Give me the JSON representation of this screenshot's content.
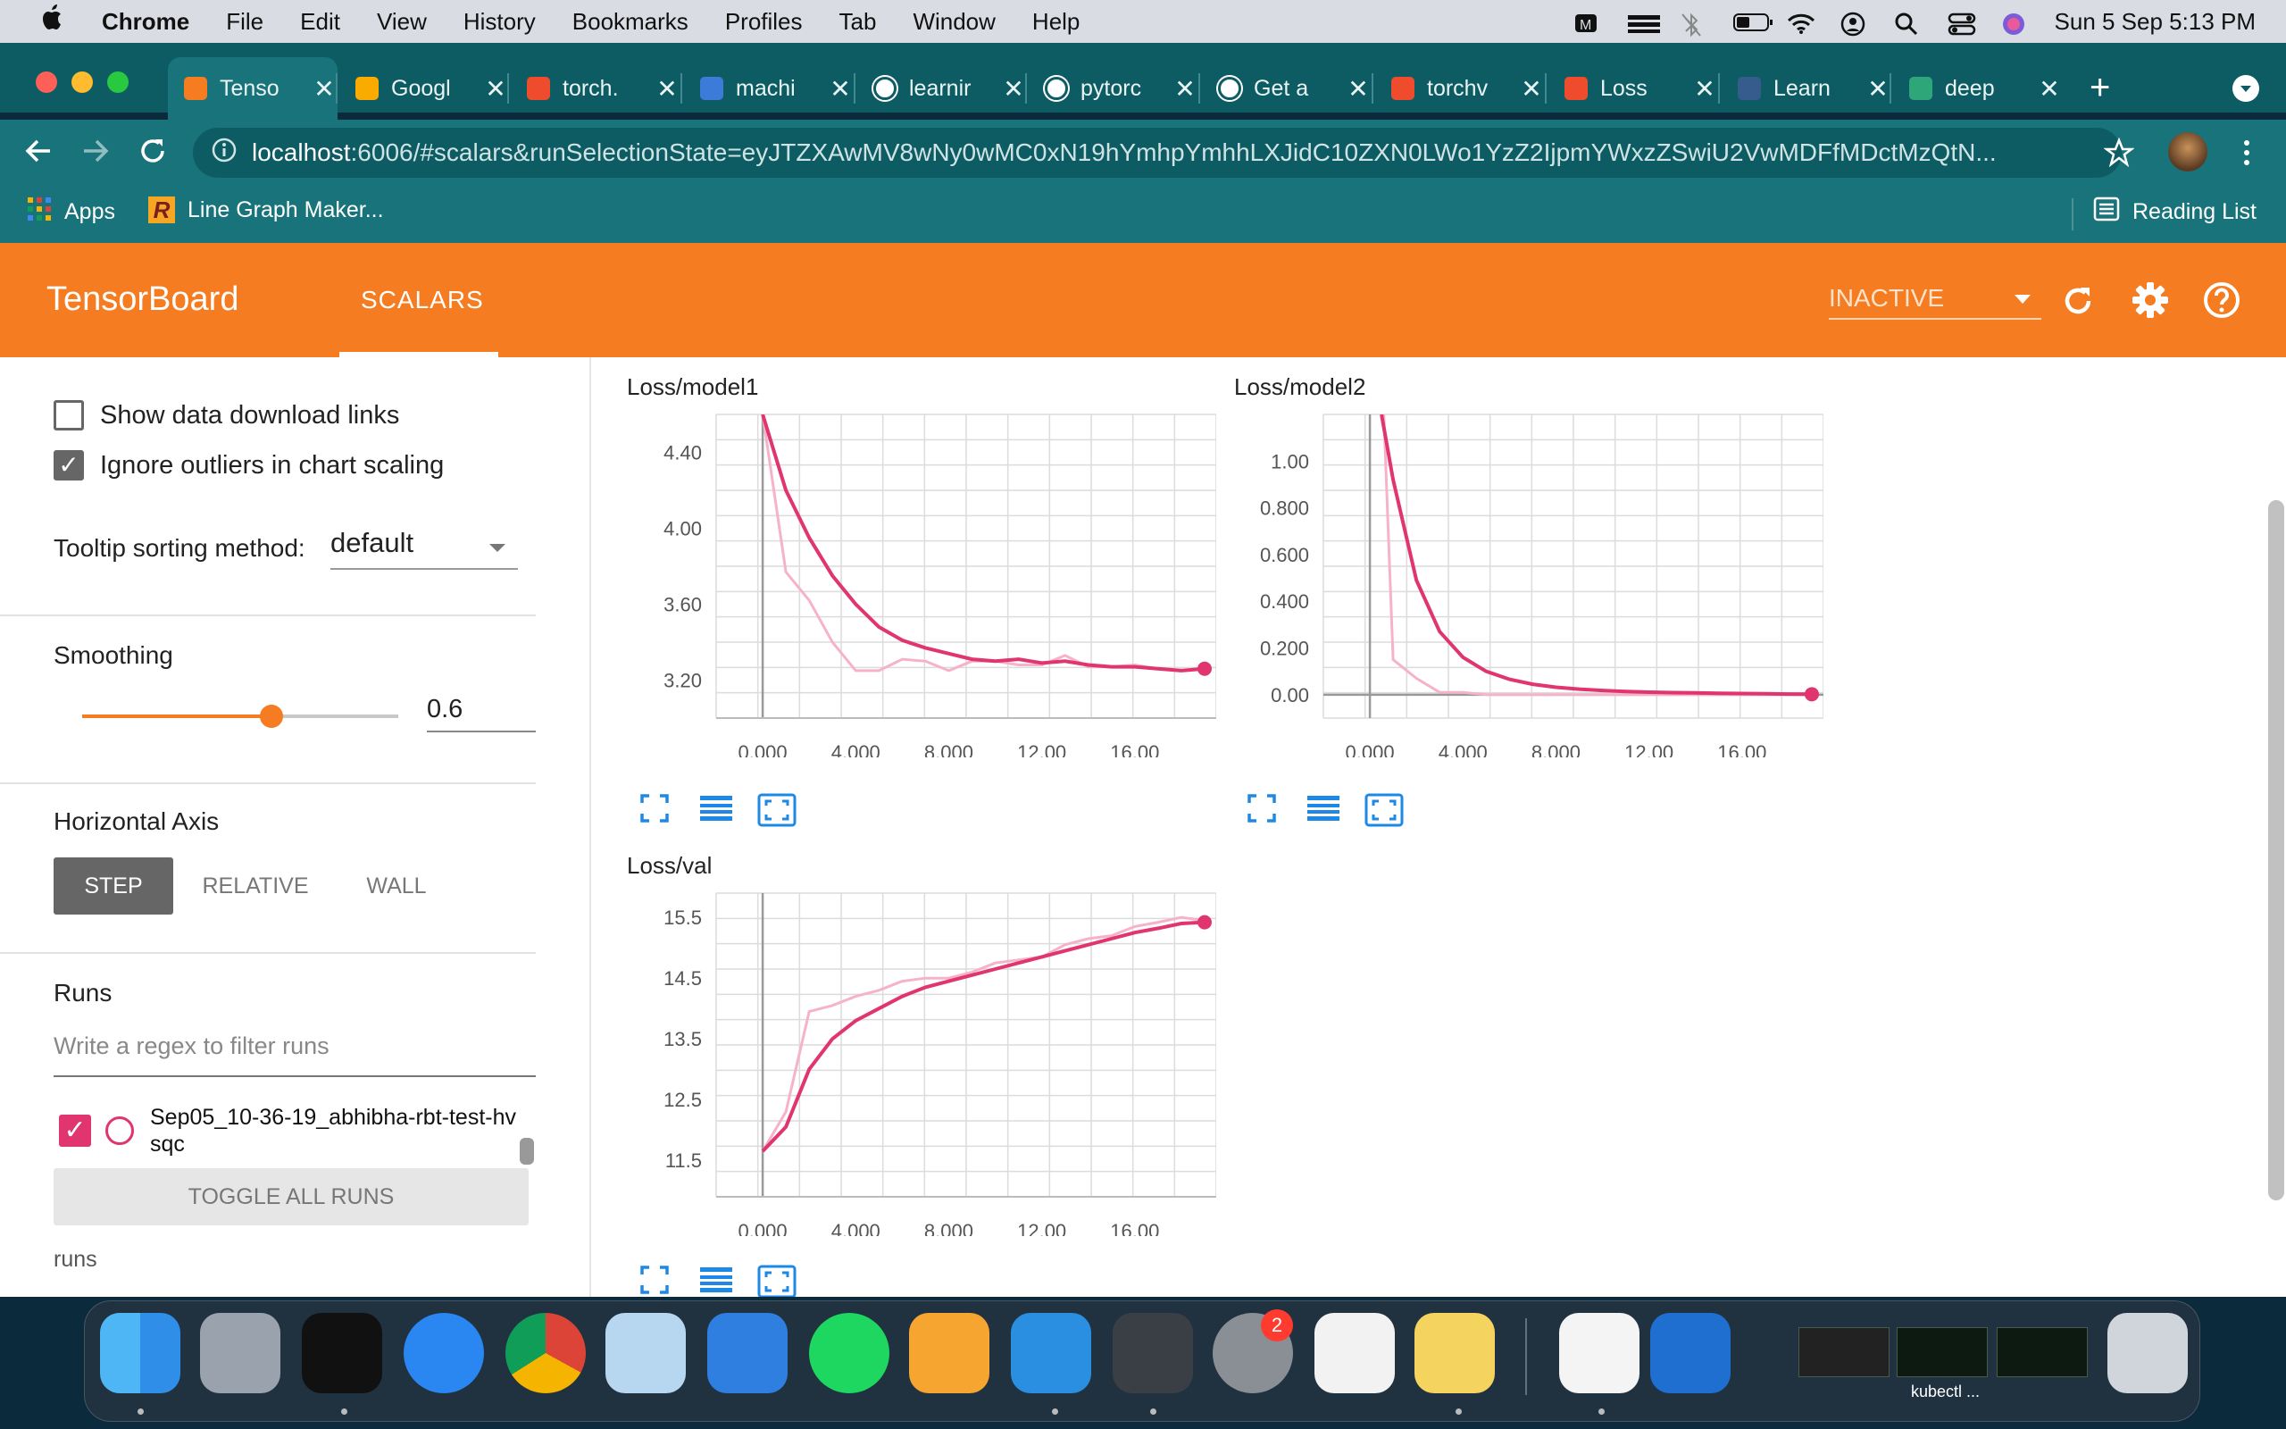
{
  "menubar": {
    "app": "Chrome",
    "items": [
      "File",
      "Edit",
      "View",
      "History",
      "Bookmarks",
      "Profiles",
      "Tab",
      "Window",
      "Help"
    ],
    "clock": "Sun 5 Sep  5:13 PM"
  },
  "tabs": [
    {
      "label": "Tenso",
      "favicon": "tensorboard-icon",
      "color": "#f57c20"
    },
    {
      "label": "Googl",
      "favicon": "colab-icon",
      "color": "#f9ab00"
    },
    {
      "label": "torch.",
      "favicon": "pytorch-icon",
      "color": "#ee4c2c"
    },
    {
      "label": "machi",
      "favicon": "ds-icon",
      "color": "#3d7bd9"
    },
    {
      "label": "learnir",
      "favicon": "google-icon",
      "color": "#ffffff"
    },
    {
      "label": "pytorc",
      "favicon": "github-icon",
      "color": "#ffffff"
    },
    {
      "label": "Get a",
      "favicon": "github-icon",
      "color": "#ffffff"
    },
    {
      "label": "torchv",
      "favicon": "pytorch-icon",
      "color": "#ee4c2c"
    },
    {
      "label": "Loss",
      "favicon": "pytorch-icon",
      "color": "#ee4c2c"
    },
    {
      "label": "Learn",
      "favicon": "tds-icon",
      "color": "#355c8c"
    },
    {
      "label": "deep",
      "favicon": "grid-icon",
      "color": "#2fa57a"
    }
  ],
  "omnibox": {
    "host": "localhost",
    "rest": ":6006/#scalars&runSelectionState=eyJTZXAwMV8wNy0wMC0xN19hYmhpYmhhLXJidC10ZXN0LWo1YzZ2IjpmYWxzZSwiU2VwMDFfMDctMzQtN..."
  },
  "bookmarks": {
    "apps": "Apps",
    "item1": "Line Graph Maker...",
    "reading_list": "Reading List"
  },
  "tensorboard": {
    "title": "TensorBoard",
    "tab": "SCALARS",
    "status": "INACTIVE"
  },
  "sidebar": {
    "show_download": "Show data download links",
    "ignore_outliers": "Ignore outliers in chart scaling",
    "tooltip_label": "Tooltip sorting method:",
    "tooltip_value": "default",
    "smoothing_label": "Smoothing",
    "smoothing_value": "0.6",
    "smoothing_fraction": 0.6,
    "haxis_label": "Horizontal Axis",
    "haxis_options": [
      "STEP",
      "RELATIVE",
      "WALL"
    ],
    "runs_label": "Runs",
    "filter_placeholder": "Write a regex to filter runs",
    "run_name": "Sep05_10-36-19_abhibha-rbt-test-hvsqc",
    "toggle_all": "TOGGLE ALL RUNS",
    "runs_dir": "runs"
  },
  "accent_color": "#e91e63",
  "chart_data": [
    {
      "type": "line",
      "title": "Loss/model1",
      "x_ticks": [
        "0.000",
        "4.000",
        "8.000",
        "12.00",
        "16.00"
      ],
      "y_ticks": [
        "3.20",
        "3.60",
        "4.00",
        "4.40"
      ],
      "xlim": [
        -2,
        19.5
      ],
      "ylim": [
        3.0,
        4.6
      ],
      "series": [
        {
          "values": [
            [
              0,
              4.6
            ],
            [
              1,
              4.2
            ],
            [
              2,
              3.95
            ],
            [
              3,
              3.75
            ],
            [
              4,
              3.6
            ],
            [
              5,
              3.48
            ],
            [
              6,
              3.41
            ],
            [
              7,
              3.37
            ],
            [
              8,
              3.34
            ],
            [
              9,
              3.31
            ],
            [
              10,
              3.3
            ],
            [
              11,
              3.31
            ],
            [
              12,
              3.29
            ],
            [
              13,
              3.3
            ],
            [
              14,
              3.28
            ],
            [
              15,
              3.27
            ],
            [
              16,
              3.27
            ],
            [
              17,
              3.26
            ],
            [
              18,
              3.25
            ],
            [
              19,
              3.26
            ]
          ],
          "color": "#e0356f"
        },
        {
          "values": [
            [
              0,
              4.6
            ],
            [
              1,
              3.77
            ],
            [
              2,
              3.62
            ],
            [
              3,
              3.4
            ],
            [
              4,
              3.25
            ],
            [
              5,
              3.25
            ],
            [
              6,
              3.31
            ],
            [
              7,
              3.3
            ],
            [
              8,
              3.25
            ],
            [
              9,
              3.3
            ],
            [
              10,
              3.3
            ],
            [
              11,
              3.28
            ],
            [
              12,
              3.28
            ],
            [
              13,
              3.33
            ],
            [
              14,
              3.27
            ],
            [
              15,
              3.27
            ],
            [
              16,
              3.28
            ],
            [
              17,
              3.26
            ],
            [
              18,
              3.25
            ],
            [
              19,
              3.26
            ]
          ],
          "color": "#f6b3c8"
        }
      ]
    },
    {
      "type": "line",
      "title": "Loss/model2",
      "x_ticks": [
        "0.000",
        "4.000",
        "8.000",
        "12.00",
        "16.00"
      ],
      "y_ticks": [
        "0.00",
        "0.200",
        "0.400",
        "0.600",
        "0.800",
        "1.00"
      ],
      "xlim": [
        -2,
        19.5
      ],
      "ylim": [
        -0.1,
        1.2
      ],
      "series": [
        {
          "values": [
            [
              0.5,
              1.2
            ],
            [
              1,
              0.92
            ],
            [
              2,
              0.49
            ],
            [
              3,
              0.27
            ],
            [
              4,
              0.16
            ],
            [
              5,
              0.1
            ],
            [
              6,
              0.066
            ],
            [
              7,
              0.045
            ],
            [
              8,
              0.032
            ],
            [
              9,
              0.024
            ],
            [
              10,
              0.018
            ],
            [
              11,
              0.014
            ],
            [
              12,
              0.011
            ],
            [
              13,
              0.009
            ],
            [
              14,
              0.008
            ],
            [
              15,
              0.006
            ],
            [
              16,
              0.005
            ],
            [
              17,
              0.004
            ],
            [
              18,
              0.003
            ],
            [
              19,
              0.002
            ]
          ],
          "color": "#e0356f"
        },
        {
          "values": [
            [
              0.6,
              1.2
            ],
            [
              1,
              0.15
            ],
            [
              2,
              0.07
            ],
            [
              3,
              0.01
            ],
            [
              4,
              0.01
            ],
            [
              5,
              0.0
            ],
            [
              6,
              0.0
            ],
            [
              8,
              0.0
            ],
            [
              10,
              0.0
            ],
            [
              12,
              0.0
            ],
            [
              14,
              0.0
            ],
            [
              16,
              0.0
            ],
            [
              19,
              0.0
            ]
          ],
          "color": "#f6b3c8"
        }
      ]
    },
    {
      "type": "line",
      "title": "Loss/val",
      "x_ticks": [
        "0.000",
        "4.000",
        "8.000",
        "12.00",
        "16.00"
      ],
      "y_ticks": [
        "11.5",
        "12.5",
        "13.5",
        "14.5",
        "15.5"
      ],
      "xlim": [
        -2,
        19.5
      ],
      "ylim": [
        10.9,
        15.9
      ],
      "series": [
        {
          "values": [
            [
              0,
              11.65
            ],
            [
              1,
              12.05
            ],
            [
              2,
              13.0
            ],
            [
              3,
              13.5
            ],
            [
              4,
              13.8
            ],
            [
              5,
              14.0
            ],
            [
              6,
              14.2
            ],
            [
              7,
              14.35
            ],
            [
              8,
              14.45
            ],
            [
              9,
              14.55
            ],
            [
              10,
              14.65
            ],
            [
              11,
              14.75
            ],
            [
              12,
              14.85
            ],
            [
              13,
              14.95
            ],
            [
              14,
              15.05
            ],
            [
              15,
              15.15
            ],
            [
              16,
              15.25
            ],
            [
              17,
              15.32
            ],
            [
              18,
              15.4
            ],
            [
              19,
              15.42
            ]
          ],
          "color": "#e0356f"
        },
        {
          "values": [
            [
              0,
              11.65
            ],
            [
              1,
              12.3
            ],
            [
              2,
              13.95
            ],
            [
              3,
              14.05
            ],
            [
              4,
              14.2
            ],
            [
              5,
              14.3
            ],
            [
              6,
              14.45
            ],
            [
              7,
              14.5
            ],
            [
              8,
              14.5
            ],
            [
              9,
              14.6
            ],
            [
              10,
              14.75
            ],
            [
              11,
              14.8
            ],
            [
              12,
              14.85
            ],
            [
              13,
              15.05
            ],
            [
              14,
              15.15
            ],
            [
              15,
              15.2
            ],
            [
              16,
              15.35
            ],
            [
              17,
              15.42
            ],
            [
              18,
              15.5
            ],
            [
              19,
              15.45
            ]
          ],
          "color": "#f6b3c8"
        }
      ]
    }
  ],
  "dock": {
    "apps": [
      "finder-icon",
      "launchpad-icon",
      "terminal-icon",
      "safari-icon",
      "chrome-icon",
      "preview-icon",
      "keynote-icon",
      "spotify-icon",
      "pages-icon",
      "vscode-icon",
      "sublime-icon",
      "system-preferences-icon",
      "numbers-icon",
      "stickies-icon",
      "textedit-icon",
      "wd-icon",
      "chrome-window-thumb",
      "kubectl-window-thumb",
      "terminal-window-thumb",
      "trash-icon"
    ],
    "badge": "2",
    "kubectl_label": "kubectl ..."
  }
}
